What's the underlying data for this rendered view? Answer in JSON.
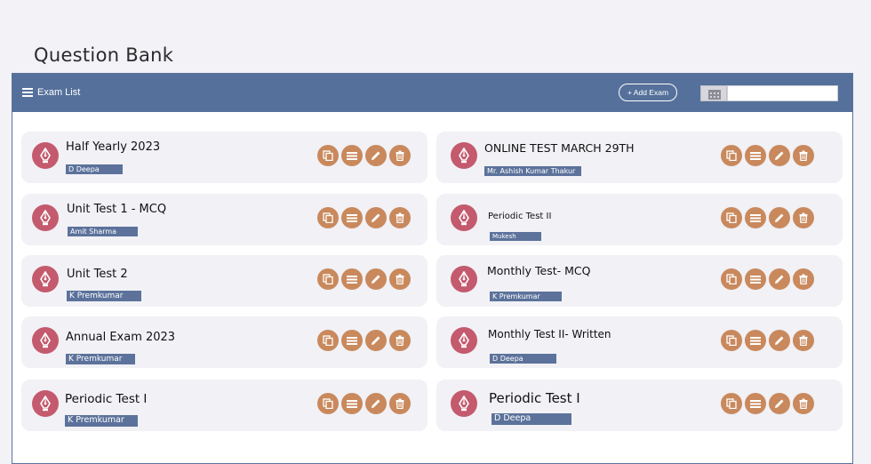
{
  "page": {
    "title": "Question Bank"
  },
  "panel": {
    "title": "Exam List",
    "add_button": "+ Add Exam",
    "date_input": {
      "value": "",
      "placeholder": ""
    }
  },
  "exams": [
    {
      "title": "Half Yearly 2023",
      "author": "D Deepa"
    },
    {
      "title": "ONLINE TEST MARCH 29TH",
      "author": "Mr. Ashish Kumar Thakur"
    },
    {
      "title": "Unit Test 1 - MCQ",
      "author": "Amit Sharma"
    },
    {
      "title": "Periodic Test II",
      "author": "Mukesh"
    },
    {
      "title": "Unit Test 2",
      "author": "K Premkumar"
    },
    {
      "title": "Monthly Test- MCQ",
      "author": "K Premkumar"
    },
    {
      "title": "Annual Exam 2023",
      "author": "K Premkumar"
    },
    {
      "title": "Monthly Test II- Written",
      "author": "D Deepa"
    },
    {
      "title": "Periodic Test I",
      "author": "K Premkumar"
    },
    {
      "title": "Periodic Test I",
      "author": "D Deepa"
    }
  ],
  "colors": {
    "header": "#55719b",
    "badge": "#c45a6d",
    "action": "#c9895d",
    "author_tag": "#5c729b"
  },
  "icons": {
    "header": "list-icon",
    "exam": "pen-nib-icon",
    "actions": [
      "copy-icon",
      "list-icon",
      "edit-icon",
      "delete-icon"
    ],
    "date": "calendar-icon"
  }
}
